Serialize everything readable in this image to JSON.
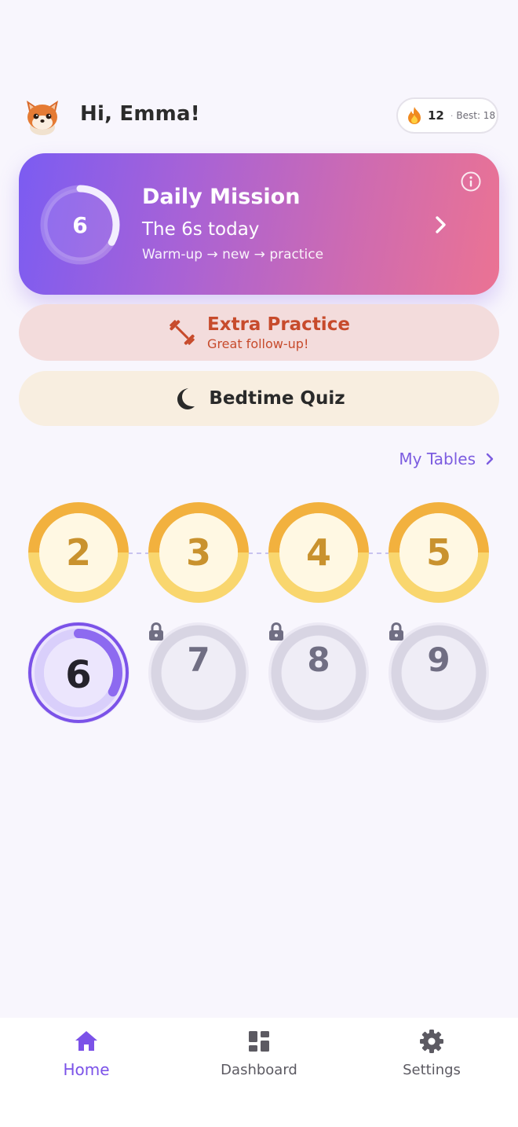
{
  "header": {
    "greeting": "Hi, Emma!",
    "avatar_icon": "fox-avatar-icon",
    "streak": {
      "icon": "flame-icon",
      "count": "12",
      "separator": "·",
      "best": "Best: 18"
    }
  },
  "mission": {
    "ring_number": "6",
    "ring_progress": 0.33,
    "title": "Daily Mission",
    "subtitle": "The 6s today",
    "detail": "Warm-up → new → practice",
    "info_icon": "info-icon",
    "chevron_icon": "chevron-right-icon"
  },
  "extra_practice": {
    "icon": "dumbbell-icon",
    "title": "Extra Practice",
    "subtitle": "Great follow-up!"
  },
  "bedtime_quiz": {
    "icon": "moon-icon",
    "label": "Bedtime Quiz"
  },
  "my_tables": {
    "label": "My Tables",
    "icon": "chevron-right-icon"
  },
  "tables": [
    {
      "number": "2",
      "state": "completed"
    },
    {
      "number": "3",
      "state": "completed"
    },
    {
      "number": "4",
      "state": "completed"
    },
    {
      "number": "5",
      "state": "completed"
    },
    {
      "number": "6",
      "state": "current",
      "progress": 0.33
    },
    {
      "number": "7",
      "state": "locked"
    },
    {
      "number": "8",
      "state": "locked"
    },
    {
      "number": "9",
      "state": "locked"
    }
  ],
  "nav": {
    "home": "Home",
    "dashboard": "Dashboard",
    "settings": "Settings",
    "active": "home"
  },
  "colors": {
    "accent": "#7b52e8",
    "mission_gradient_start": "#7b5cf2",
    "mission_gradient_end": "#eb7393",
    "gold": "#f2b13e",
    "extra_text": "#c74b2c"
  }
}
